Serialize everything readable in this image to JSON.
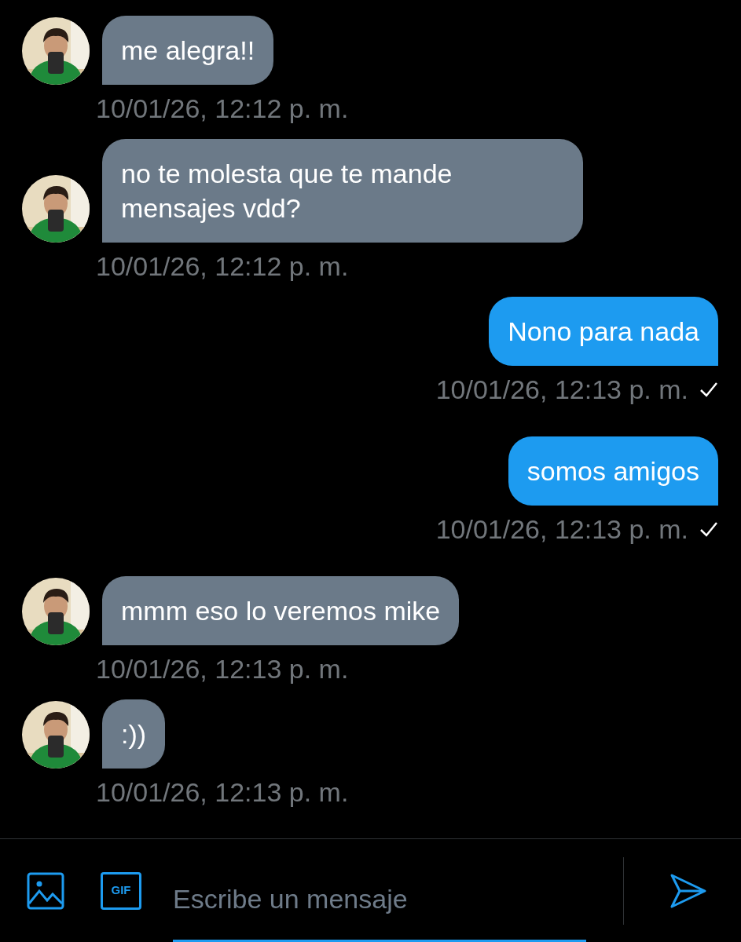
{
  "messages": [
    {
      "kind": "received",
      "text": "me alegra!!",
      "time": "10/01/26, 12:12 p. m."
    },
    {
      "kind": "received",
      "text": "no te molesta que te mande mensajes vdd?",
      "time": "10/01/26, 12:12 p. m."
    },
    {
      "kind": "sent",
      "text": "Nono para nada",
      "time": "10/01/26, 12:13 p. m."
    },
    {
      "kind": "sent",
      "text": "somos amigos",
      "time": "10/01/26, 12:13 p. m."
    },
    {
      "kind": "received",
      "text": "mmm eso lo veremos mike",
      "time": "10/01/26, 12:13 p. m."
    },
    {
      "kind": "received",
      "text": ":))",
      "time": "10/01/26, 12:13 p. m."
    }
  ],
  "composer": {
    "gif_label": "GIF",
    "placeholder": "Escribe un mensaje"
  }
}
